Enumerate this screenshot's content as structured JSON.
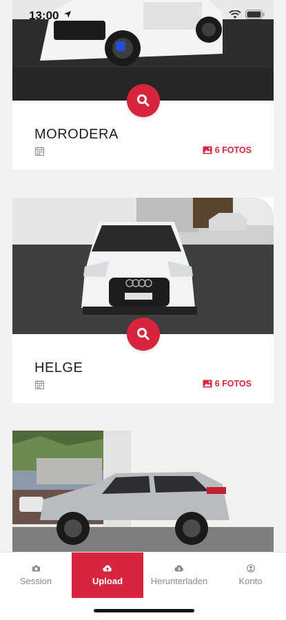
{
  "status_bar": {
    "time": "13:00"
  },
  "cards": [
    {
      "title": "MORODERA",
      "photos_label": "6 FOTOS"
    },
    {
      "title": "HELGE",
      "photos_label": "6 FOTOS"
    }
  ],
  "tab_bar": {
    "items": [
      {
        "label": "Session",
        "icon": "camera-icon",
        "active": false
      },
      {
        "label": "Upload",
        "icon": "cloud-upload-icon",
        "active": true
      },
      {
        "label": "Herunterladen",
        "icon": "cloud-download-icon",
        "active": false
      },
      {
        "label": "Konto",
        "icon": "user-icon",
        "active": false
      }
    ]
  },
  "colors": {
    "accent": "#d8253d",
    "background": "#f2f2f2",
    "card": "#ffffff"
  }
}
